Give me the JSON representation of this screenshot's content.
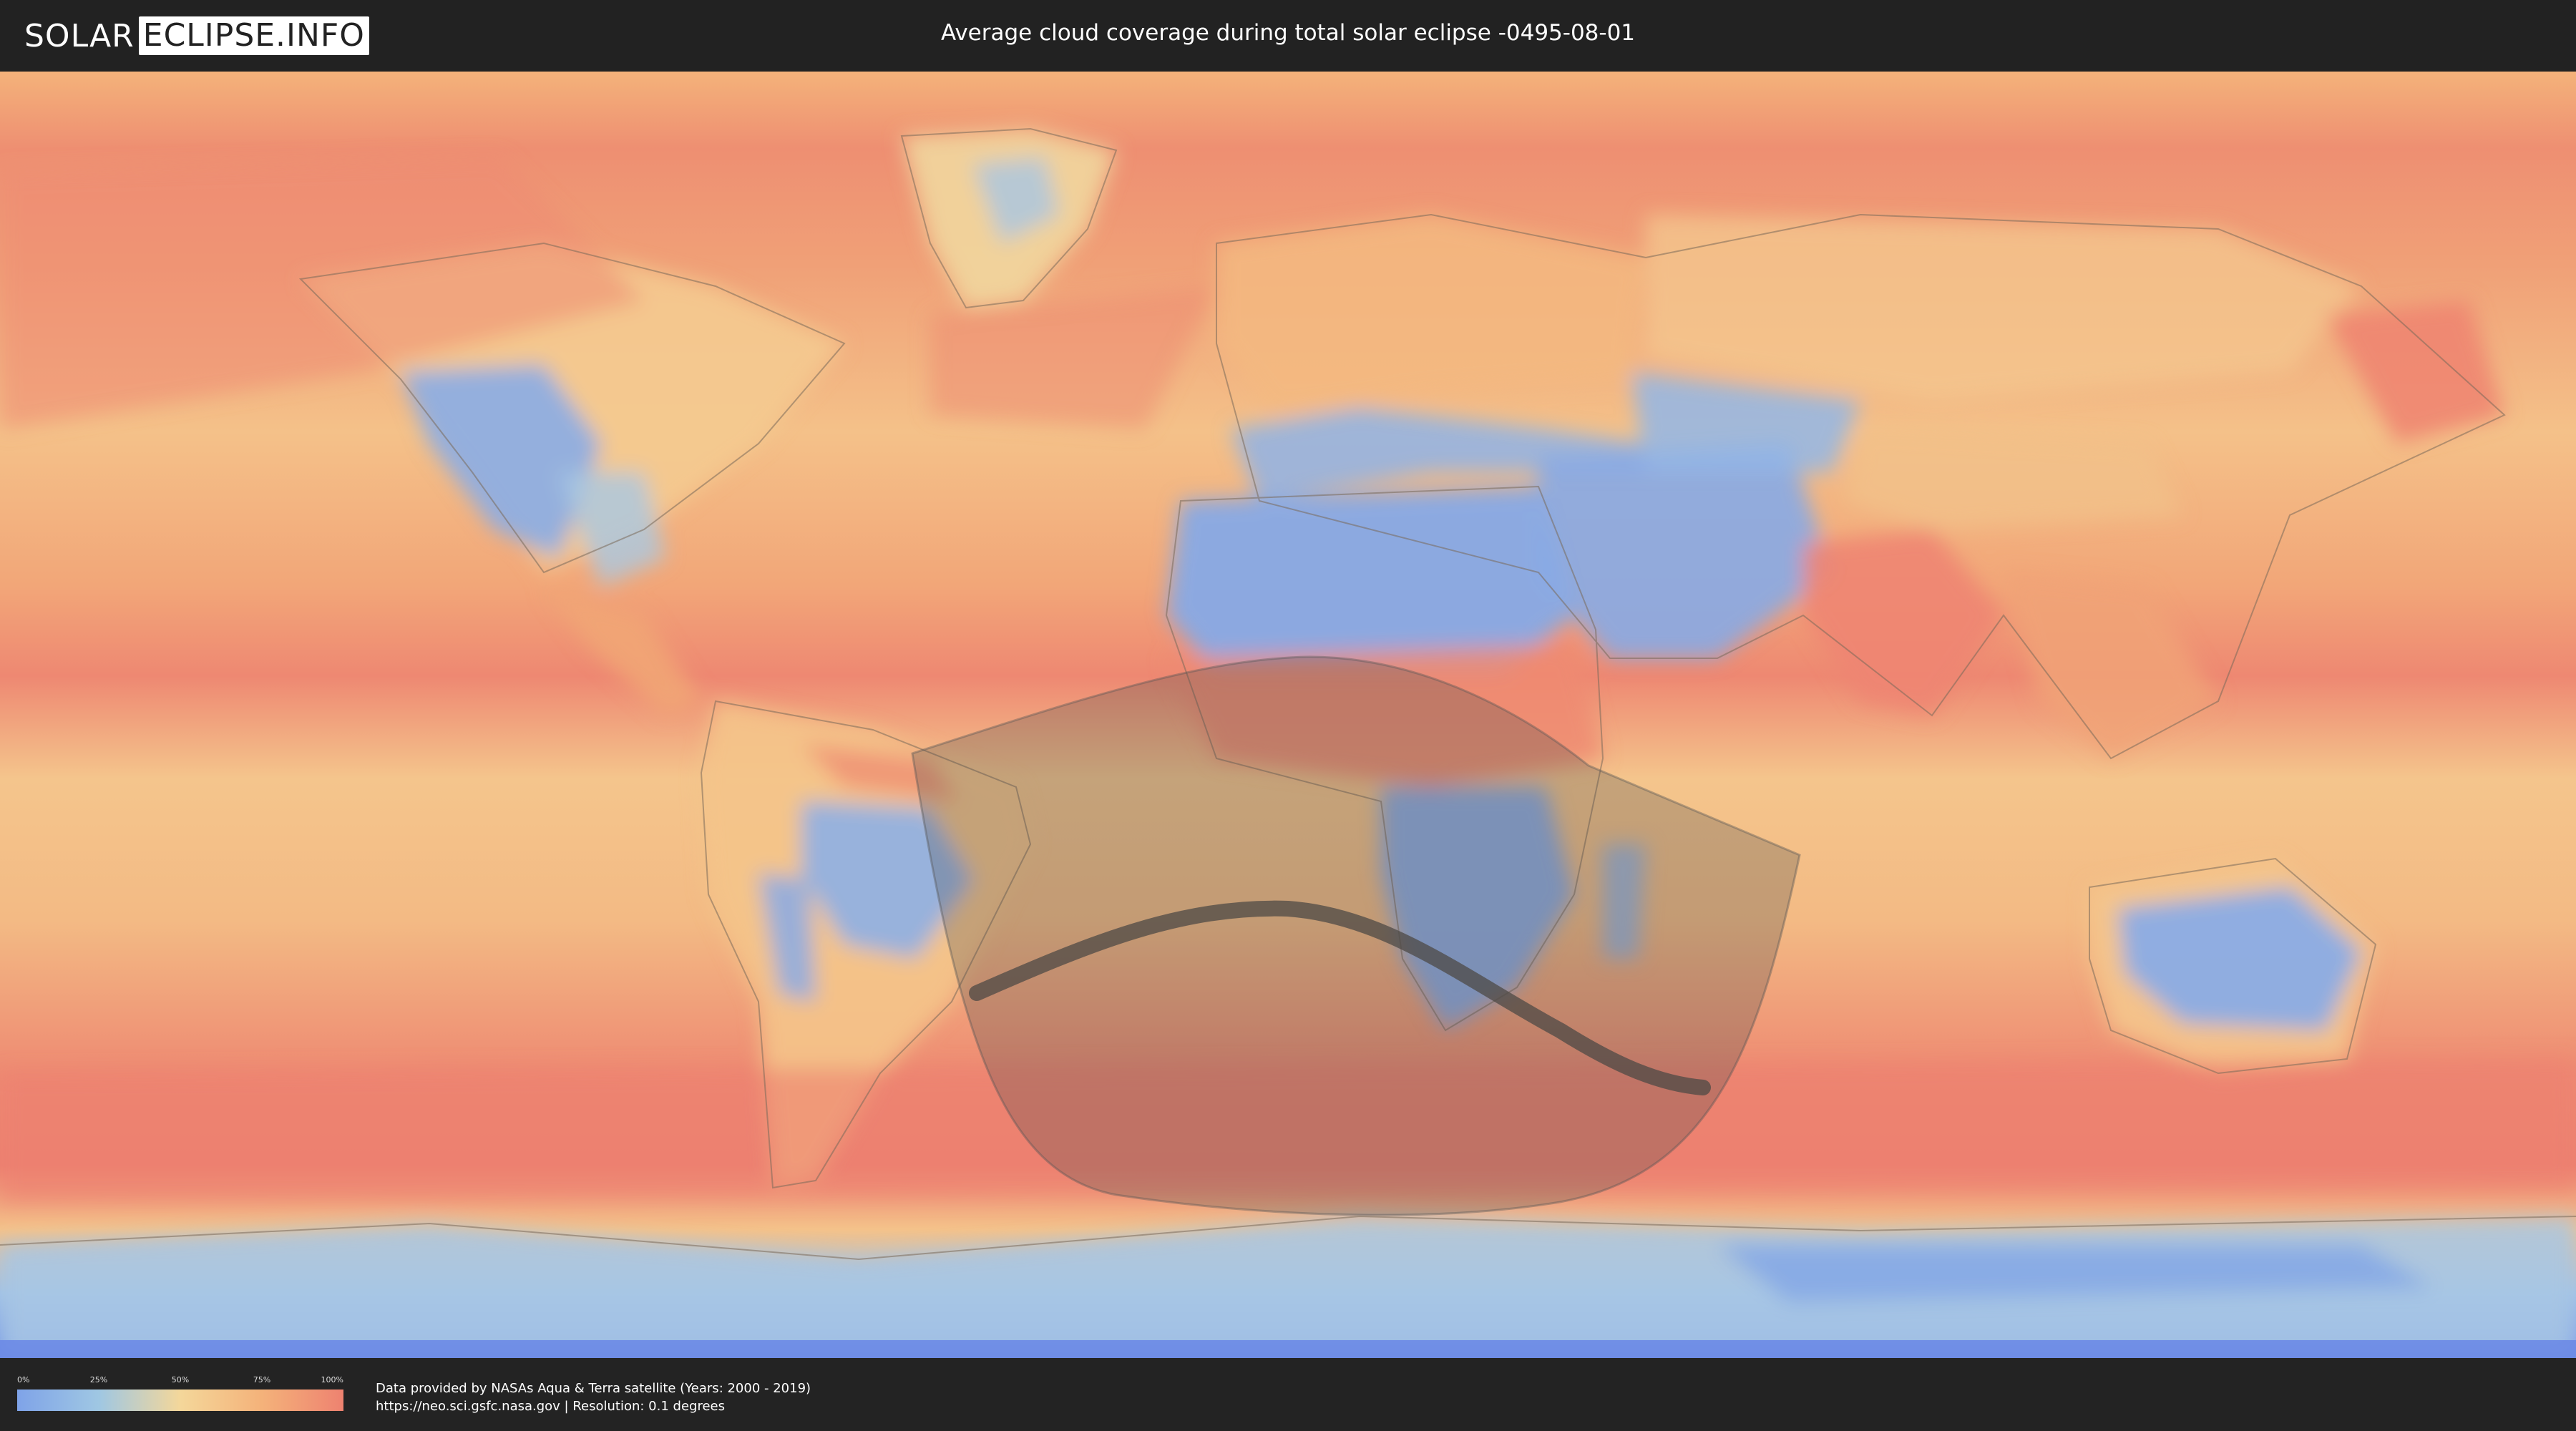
{
  "header": {
    "logo_part1": "SOLAR",
    "logo_part2": "ECLIPSE.INFO",
    "title": "Average cloud coverage during total solar eclipse -0495-08-01"
  },
  "legend": {
    "ticks": [
      "0%",
      "25%",
      "50%",
      "75%",
      "100%"
    ],
    "tick_values": [
      0,
      25,
      50,
      75,
      100
    ],
    "colors": {
      "low": "#7fa3e8",
      "mid_low": "#9fc7e3",
      "mid": "#f4d79a",
      "mid_high": "#f4b27a",
      "high": "#ee8270"
    }
  },
  "footer": {
    "line1": "Data provided by NASAs Aqua & Terra satellite (Years: 2000 - 2019)",
    "line2": "https://neo.sci.gsfc.nasa.gov | Resolution: 0.1 degrees"
  },
  "map": {
    "icons": [
      "eclipse-visibility-zone",
      "totality-path"
    ],
    "colors": {
      "ocean_cloudy": "#ee8270",
      "ocean_mixed": "#f4b27a",
      "land_clear": "#86a9e6",
      "shadow": "#555555"
    }
  }
}
